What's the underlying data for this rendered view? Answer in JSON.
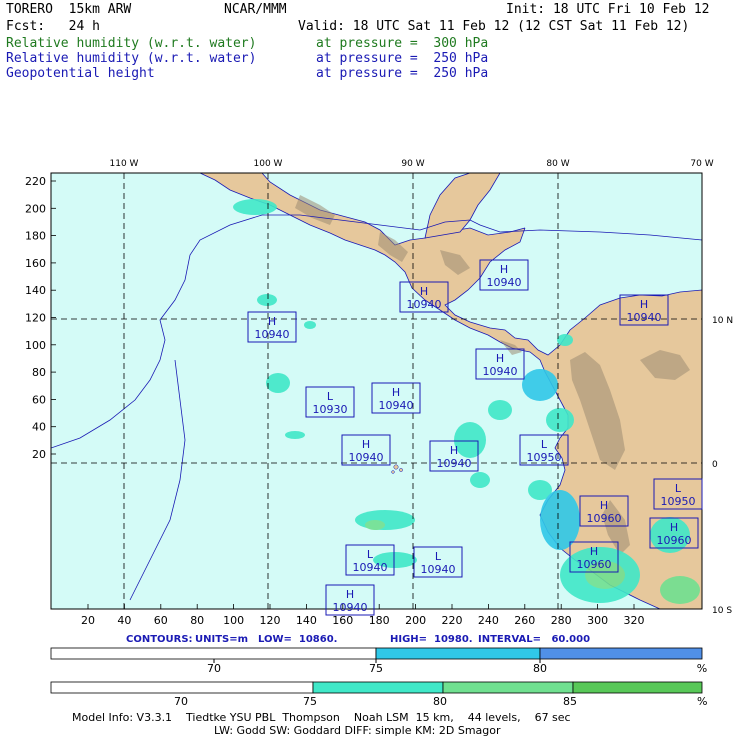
{
  "header": {
    "model": "TORERO  15km ARW",
    "org": "NCAR/MMM",
    "init": "Init: 18 UTC Fri 10 Feb 12",
    "fcst": "Fcst:   24 h",
    "valid": "Valid: 18 UTC Sat 11 Feb 12 (12 CST Sat 11 Feb 12)",
    "fields": [
      {
        "name": "Relative humidity (w.r.t. water)",
        "level": "at pressure =  300 hPa",
        "color": "#1f7a1f"
      },
      {
        "name": "Relative humidity (w.r.t. water)",
        "level": "at pressure =  250 hPa",
        "color": "#1a1ab4"
      },
      {
        "name": "Geopotential height",
        "level": "at pressure =  250 hPa",
        "color": "#1a1ab4"
      }
    ]
  },
  "map": {
    "top_lon_labels": [
      "110 W",
      "100 W",
      "90 W",
      "80 W",
      "70 W"
    ],
    "right_lat_labels": [
      "10 N",
      "0",
      "10 S"
    ],
    "left_y_ticks": [
      "220",
      "200",
      "180",
      "160",
      "140",
      "120",
      "100",
      "80",
      "60",
      "40",
      "20"
    ],
    "bottom_x_ticks": [
      "20",
      "40",
      "60",
      "80",
      "100",
      "120",
      "140",
      "160",
      "180",
      "200",
      "220",
      "240",
      "260",
      "280",
      "300",
      "320"
    ],
    "centers": [
      {
        "type": "H",
        "value": "10940"
      },
      {
        "type": "H",
        "value": "10940"
      },
      {
        "type": "H",
        "value": "10940"
      },
      {
        "type": "H",
        "value": "10940"
      },
      {
        "type": "H",
        "value": "10940"
      },
      {
        "type": "L",
        "value": "10930"
      },
      {
        "type": "H",
        "value": "10940"
      },
      {
        "type": "H",
        "value": "10940"
      },
      {
        "type": "H",
        "value": "10940"
      },
      {
        "type": "L",
        "value": "10950"
      },
      {
        "type": "H",
        "value": "10960"
      },
      {
        "type": "L",
        "value": "10950"
      },
      {
        "type": "H",
        "value": "10960"
      },
      {
        "type": "H",
        "value": "10960"
      },
      {
        "type": "L",
        "value": "10940"
      },
      {
        "type": "L",
        "value": "10940"
      },
      {
        "type": "H",
        "value": "10940"
      }
    ],
    "colors": {
      "ocean": "#d4fbf7",
      "land": "#e6c89c",
      "terrain": "#9c8c72",
      "frame": "#1a1ab4"
    }
  },
  "contour_info": {
    "label": "CONTOURS:",
    "units": "UNITS=m",
    "low": "LOW=  10860.",
    "high": "HIGH=  10980.",
    "interval": "INTERVAL=   60.000"
  },
  "colorbars": [
    {
      "labels": [
        "70",
        "75",
        "80",
        "%"
      ],
      "colors": [
        "#ffffff",
        "#30c8e8",
        "#5090e8"
      ]
    },
    {
      "labels": [
        "70",
        "75",
        "80",
        "85",
        "%"
      ],
      "colors": [
        "#ffffff",
        "#40e8c8",
        "#70e090",
        "#58c858"
      ]
    }
  ],
  "footer": {
    "line1": "Model Info: V3.3.1    Tiedtke YSU PBL  Thompson    Noah LSM  15 km,    44 levels,    67 sec",
    "line2": "LW: Godd SW: Goddard DIFF: simple KM: 2D Smagor"
  }
}
